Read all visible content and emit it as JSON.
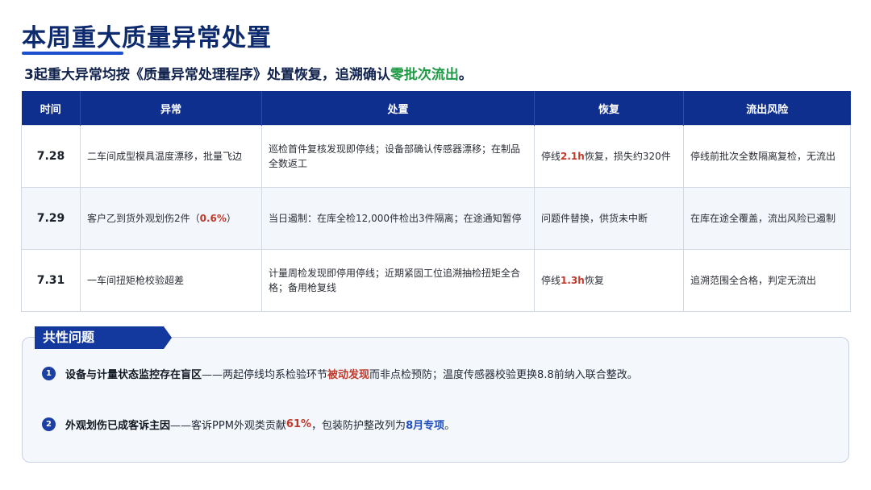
{
  "header": {
    "title": "本周重大质量异常处置",
    "subtitle_prefix": "3起重大异常均按《质量异常处理程序》处置恢复，追溯确认",
    "subtitle_highlight": "零批次流出",
    "subtitle_suffix": "。"
  },
  "table": {
    "columns": [
      "时间",
      "异常",
      "处置",
      "恢复",
      "流出风险"
    ],
    "rows": [
      {
        "date": "7.28",
        "issue": "二车间成型模具温度漂移，批量飞边",
        "issue_highlight": "",
        "issue_suffix": "",
        "action": "巡检首件复核发现即停线；设备部确认传感器漂移；在制品全数返工",
        "recovery_prefix": "停线",
        "recovery_highlight": "2.1h",
        "recovery_suffix": "恢复，损失约320件",
        "risk": "停线前批次全数隔离复检，无流出"
      },
      {
        "date": "7.29",
        "issue": "客户乙到货外观划伤2件（",
        "issue_highlight": "0.6%",
        "issue_suffix": "）",
        "action": "当日遏制：在库全检12,000件检出3件隔离；在途通知暂停",
        "recovery_prefix": "问题件替换，供货未中断",
        "recovery_highlight": "",
        "recovery_suffix": "",
        "risk": "在库在途全覆盖，流出风险已遏制"
      },
      {
        "date": "7.31",
        "issue": "一车间扭矩枪校验超差",
        "issue_highlight": "",
        "issue_suffix": "",
        "action": "计量周检发现即停用停线；近期紧固工位追溯抽检扭矩全合格；备用枪复线",
        "recovery_prefix": "停线",
        "recovery_highlight": "1.3h",
        "recovery_suffix": "恢复",
        "risk": "追溯范围全合格，判定无流出"
      }
    ]
  },
  "common_issues": {
    "tab_label": "共性问题",
    "points": [
      {
        "number": "1",
        "lead": "设备与计量状态监控存在盲区",
        "text_a": "——两起停线均系检验环节",
        "highlight": "被动发现",
        "text_b": "而非点检预防；温度传感器校验更换8.8前纳入联合整改。",
        "highlight2": "",
        "text_c": ""
      },
      {
        "number": "2",
        "lead": "外观划伤已成客诉主因",
        "text_a": "——客诉PPM外观类贡献",
        "highlight": "61%",
        "text_b": "，包装防护整改列为",
        "highlight2": "8月专项",
        "text_c": "。"
      }
    ]
  },
  "colors": {
    "brand_navy": "#0f2f8f",
    "highlight_green": "#1f9a45",
    "highlight_red": "#c0392b",
    "highlight_blue": "#1f4fbf"
  }
}
